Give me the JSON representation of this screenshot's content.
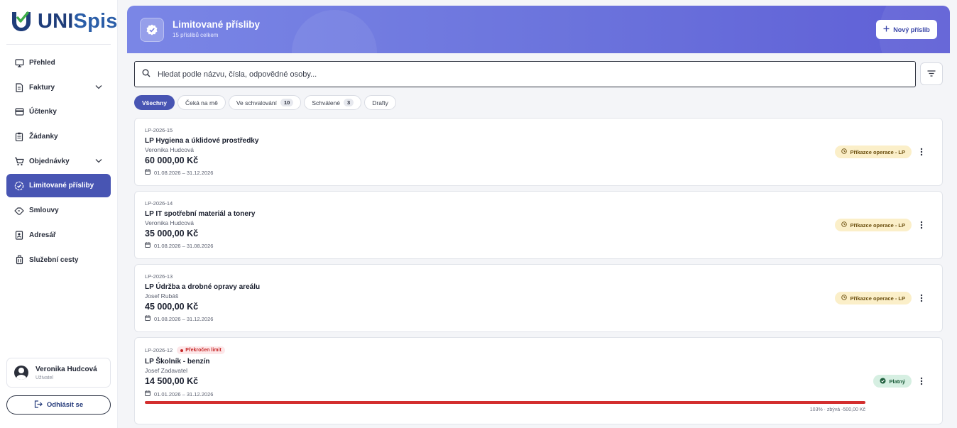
{
  "brand": {
    "uni": "UNI",
    "spis": "Spis"
  },
  "nav": [
    {
      "label": "Přehled",
      "icon": "monitor-icon"
    },
    {
      "label": "Faktury",
      "icon": "invoice-icon",
      "expandable": true
    },
    {
      "label": "Účtenky",
      "icon": "wallet-icon"
    },
    {
      "label": "Žádanky",
      "icon": "clipboard-icon"
    },
    {
      "label": "Objednávky",
      "icon": "cart-icon",
      "expandable": true
    },
    {
      "label": "Limitované přísliby",
      "icon": "verified-badge-icon",
      "active": true
    },
    {
      "label": "Smlouvy",
      "icon": "handshake-icon"
    },
    {
      "label": "Adresář",
      "icon": "contact-book-icon"
    },
    {
      "label": "Služební cesty",
      "icon": "luggage-icon"
    }
  ],
  "user": {
    "name": "Veronika Hudcová",
    "role": "Uživatel"
  },
  "logout_label": "Odhlásit se",
  "header": {
    "title": "Limitované přísliby",
    "subtitle": "15 příslibů celkem",
    "new_button": "Nový příslib"
  },
  "search": {
    "placeholder": "Hledat podle názvu, čísla, odpovědné osoby..."
  },
  "tabs": [
    {
      "label": "Všechny",
      "active": true
    },
    {
      "label": "Čeká na mě"
    },
    {
      "label": "Ve schvalování",
      "count": "10"
    },
    {
      "label": "Schválené",
      "count": "3"
    },
    {
      "label": "Drafty"
    }
  ],
  "cards": [
    {
      "code": "LP-2026-15",
      "title": "LP Hygiena a úklidové prostředky",
      "owner": "Veronika Hudcová",
      "amount": "60 000,00 Kč",
      "dates": "01.08.2026 – 31.12.2026",
      "status": "Příkazce operace - LP",
      "status_type": "pending"
    },
    {
      "code": "LP-2026-14",
      "title": "LP IT spotřební materiál a tonery",
      "owner": "Veronika Hudcová",
      "amount": "35 000,00 Kč",
      "dates": "01.08.2026 – 31.08.2026",
      "status": "Příkazce operace - LP",
      "status_type": "pending"
    },
    {
      "code": "LP-2026-13",
      "title": "LP Údržba a drobné opravy areálu",
      "owner": "Josef Rubáš",
      "amount": "45 000,00 Kč",
      "dates": "01.08.2026 – 31.12.2026",
      "status": "Příkazce operace - LP",
      "status_type": "pending"
    },
    {
      "code": "LP-2026-12",
      "limit_badge": "Překročen limit",
      "title": "LP Školník - benzín",
      "owner": "Josef Zadavatel",
      "amount": "14 500,00 Kč",
      "dates": "01.01.2026 – 31.12.2026",
      "status": "Platný",
      "status_type": "valid",
      "progress_percent": 103,
      "progress_label": "103% · zbývá -500,00 Kč"
    }
  ],
  "colors": {
    "accent": "#4855b3",
    "banner_start": "#7a86e6",
    "banner_end": "#5f5fd6",
    "pending_bg": "#fbefc9",
    "valid_bg": "#d6efe2",
    "over_limit": "#d32f2f"
  }
}
